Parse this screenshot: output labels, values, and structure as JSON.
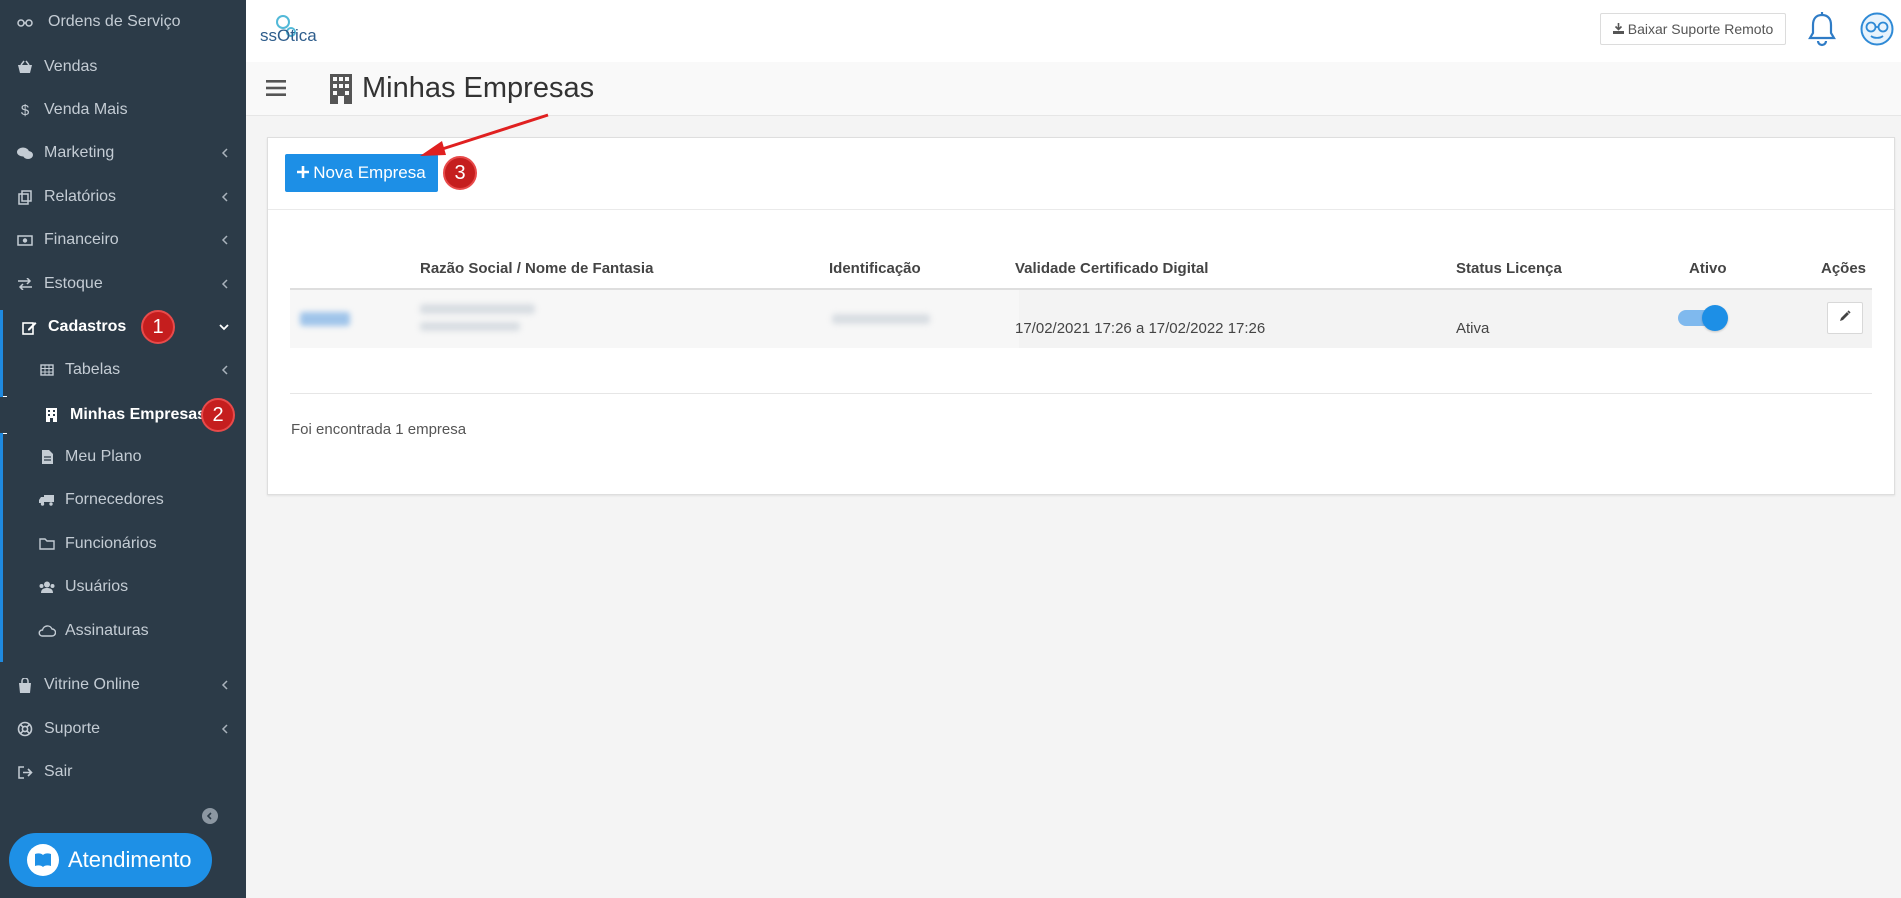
{
  "sidebar": {
    "items": [
      {
        "label": "Ordens de Serviço",
        "icon": "glasses-icon"
      },
      {
        "label": "Vendas",
        "icon": "basket-icon"
      },
      {
        "label": "Venda Mais",
        "icon": "dollar-icon"
      },
      {
        "label": "Marketing",
        "icon": "comments-icon"
      },
      {
        "label": "Relatórios",
        "icon": "copy-icon"
      },
      {
        "label": "Financeiro",
        "icon": "money-icon"
      },
      {
        "label": "Estoque",
        "icon": "exchange-icon"
      },
      {
        "label": "Cadastros",
        "icon": "edit-icon"
      }
    ],
    "sub_items": [
      {
        "label": "Tabelas",
        "icon": "table-icon"
      },
      {
        "label": "Minhas Empresas",
        "icon": "building-icon"
      },
      {
        "label": "Meu Plano",
        "icon": "file-icon"
      },
      {
        "label": "Fornecedores",
        "icon": "truck-icon"
      },
      {
        "label": "Funcionários",
        "icon": "folder-icon"
      },
      {
        "label": "Usuários",
        "icon": "users-icon"
      },
      {
        "label": "Assinaturas",
        "icon": "cloud-icon"
      }
    ],
    "bottom_items": [
      {
        "label": "Vitrine Online",
        "icon": "shopping-bag-icon"
      },
      {
        "label": "Suporte",
        "icon": "life-ring-icon"
      },
      {
        "label": "Sair",
        "icon": "sign-out-icon"
      }
    ],
    "atendimento": "Atendimento"
  },
  "annotations": {
    "one": "1",
    "two": "2",
    "three": "3"
  },
  "topbar": {
    "logo": "ssOtica",
    "remote_support": "Baixar Suporte Remoto"
  },
  "header": {
    "title": "Minhas Empresas"
  },
  "panel": {
    "new_button": "Nova Empresa",
    "columns": [
      "Razão Social / Nome de Fantasia",
      "Identificação",
      "Validade Certificado Digital",
      "Status Licença",
      "Ativo",
      "Ações"
    ],
    "rows": [
      {
        "certificado": "17/02/2021 17:26 a 17/02/2022 17:26",
        "status": "Ativa",
        "ativo": true
      }
    ],
    "found_text": "Foi encontrada 1 empresa"
  },
  "colors": {
    "sidebar_bg": "#2c3b48",
    "accent": "#1d8fe6",
    "badge": "#c51e1e"
  }
}
